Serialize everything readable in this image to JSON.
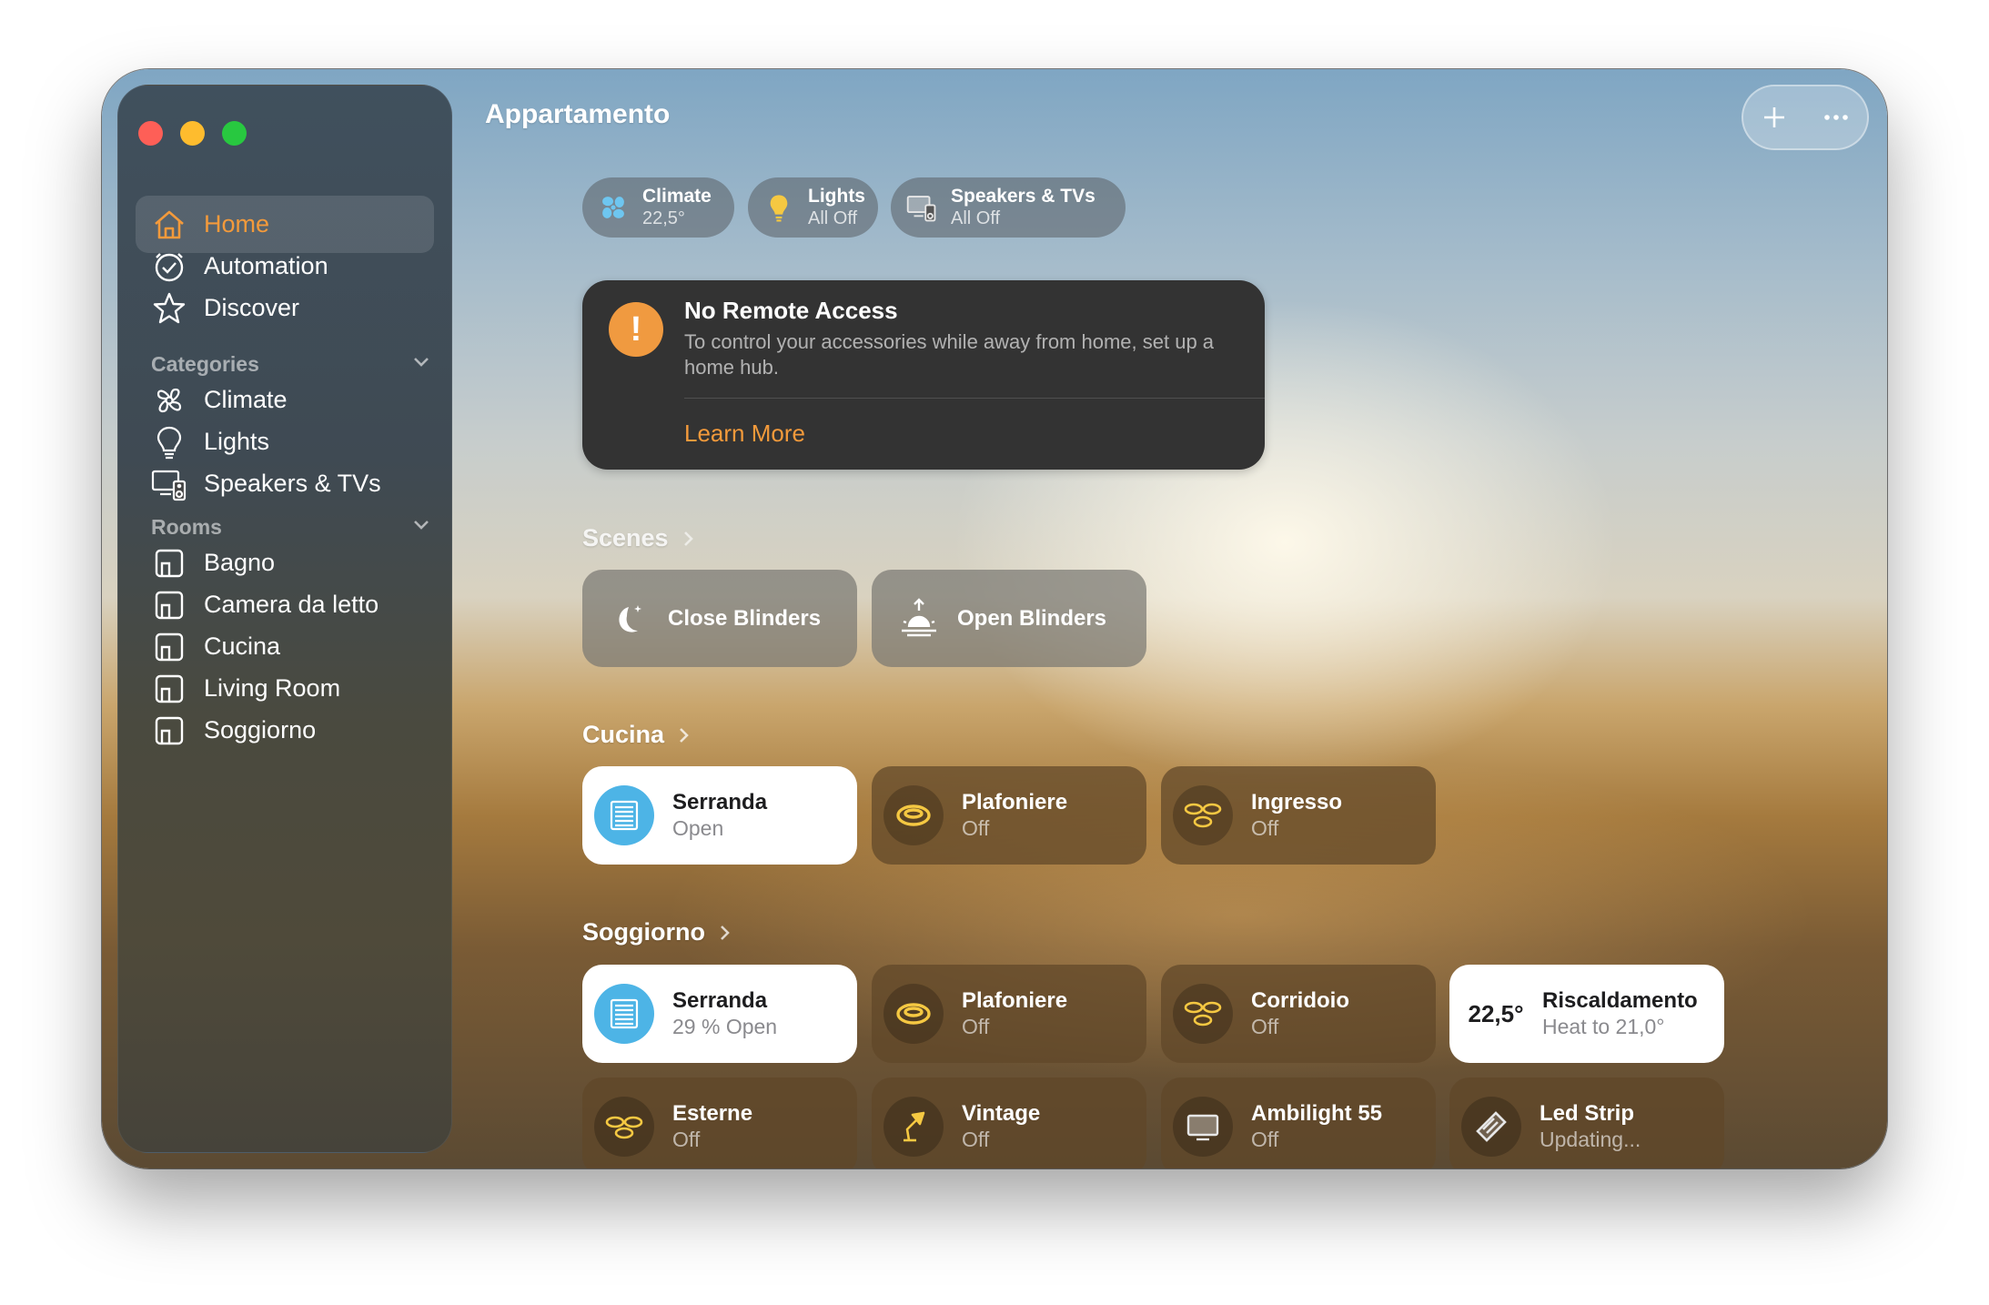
{
  "sidebar": {
    "nav": [
      {
        "label": "Home",
        "icon": "house-icon",
        "active": true
      },
      {
        "label": "Automation",
        "icon": "clock-check-icon"
      },
      {
        "label": "Discover",
        "icon": "star-icon"
      }
    ],
    "categories_label": "Categories",
    "categories": [
      {
        "label": "Climate",
        "icon": "fan-icon"
      },
      {
        "label": "Lights",
        "icon": "lightbulb-icon"
      },
      {
        "label": "Speakers & TVs",
        "icon": "tv-speaker-icon"
      }
    ],
    "rooms_label": "Rooms",
    "rooms": [
      {
        "label": "Bagno",
        "icon": "room-icon"
      },
      {
        "label": "Camera da letto",
        "icon": "room-icon"
      },
      {
        "label": "Cucina",
        "icon": "room-icon"
      },
      {
        "label": "Living Room",
        "icon": "room-icon"
      },
      {
        "label": "Soggiorno",
        "icon": "room-icon"
      }
    ]
  },
  "header": {
    "title": "Appartamento"
  },
  "summary_pills": [
    {
      "name": "Climate",
      "value": "22,5°",
      "icon": "fan-icon",
      "color": "#6ec6f0"
    },
    {
      "name": "Lights",
      "value": "All Off",
      "icon": "lightbulb-icon",
      "color": "#f5c842"
    },
    {
      "name": "Speakers & TVs",
      "value": "All Off",
      "icon": "tv-speaker-icon",
      "color": "#e6e6e6"
    }
  ],
  "alert": {
    "badge": "!",
    "title": "No Remote Access",
    "body": "To control your accessories while away from home, set up a home hub.",
    "link": "Learn More"
  },
  "scenes": {
    "label": "Scenes",
    "items": [
      {
        "name": "Close Blinders",
        "icon": "moon-stars-icon"
      },
      {
        "name": "Open Blinders",
        "icon": "sunrise-icon"
      }
    ]
  },
  "rooms": [
    {
      "label": "Cucina",
      "tiles": [
        {
          "name": "Serranda",
          "status": "Open",
          "icon": "blinds-icon",
          "style": "light"
        },
        {
          "name": "Plafoniere",
          "status": "Off",
          "icon": "ceiling-light-icon",
          "style": "dark"
        },
        {
          "name": "Ingresso",
          "status": "Off",
          "icon": "ceiling-lights-group-icon",
          "style": "dark"
        }
      ]
    },
    {
      "label": "Soggiorno",
      "tiles": [
        {
          "name": "Serranda",
          "status": "29 % Open",
          "icon": "blinds-icon",
          "style": "light"
        },
        {
          "name": "Plafoniere",
          "status": "Off",
          "icon": "ceiling-light-icon",
          "style": "dark"
        },
        {
          "name": "Corridoio",
          "status": "Off",
          "icon": "ceiling-lights-group-icon",
          "style": "dark"
        },
        {
          "name": "Riscaldamento",
          "status": "Heat to 21,0°",
          "temp": "22,5°",
          "icon": "thermostat",
          "style": "light"
        },
        {
          "name": "Esterne",
          "status": "Off",
          "icon": "ceiling-lights-group-icon",
          "style": "dark"
        },
        {
          "name": "Vintage",
          "status": "Off",
          "icon": "desk-lamp-icon",
          "style": "dark"
        },
        {
          "name": "Ambilight 55",
          "status": "Off",
          "icon": "tv-icon",
          "style": "dark"
        },
        {
          "name": "Led Strip",
          "status": "Updating...",
          "icon": "led-strip-icon",
          "style": "dark"
        }
      ]
    }
  ]
}
